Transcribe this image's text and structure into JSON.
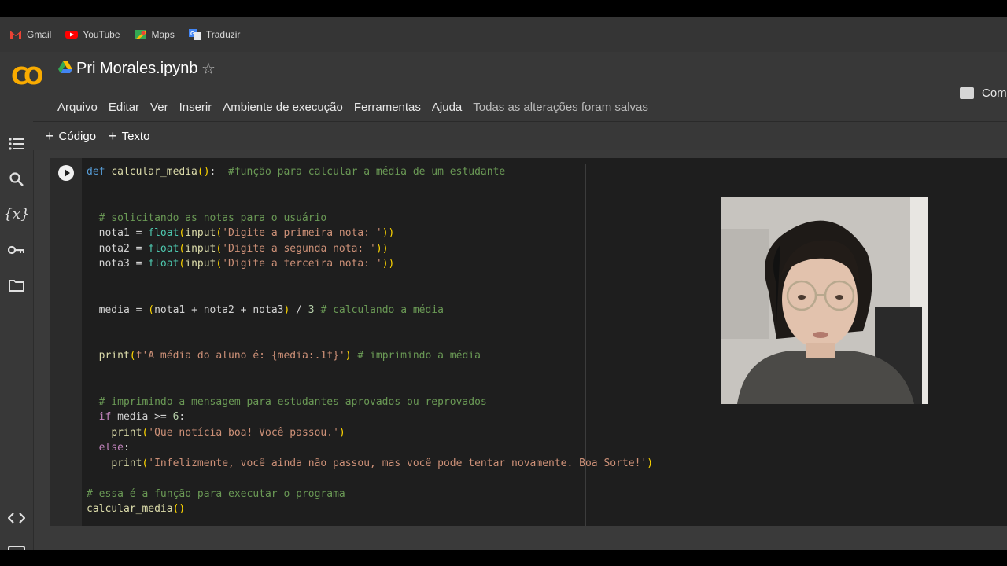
{
  "bookmarks": [
    {
      "label": "Gmail",
      "icon": "gmail-icon",
      "color": "#ea4335"
    },
    {
      "label": "YouTube",
      "icon": "youtube-icon",
      "color": "#ff0000"
    },
    {
      "label": "Maps",
      "icon": "maps-icon",
      "color": "#34a853"
    },
    {
      "label": "Traduzir",
      "icon": "translate-icon",
      "color": "#4285f4"
    }
  ],
  "header": {
    "logo": "CO",
    "notebook_title": "Pri Morales.ipynb",
    "star": "☆",
    "comment_label": "Come",
    "menu": [
      "Arquivo",
      "Editar",
      "Ver",
      "Inserir",
      "Ambiente de execução",
      "Ferramentas",
      "Ajuda"
    ],
    "saved_status": "Todas as alterações foram salvas"
  },
  "toolbar": {
    "code_label": "Código",
    "text_label": "Texto"
  },
  "sidebar": {
    "icons": [
      "table-of-contents-icon",
      "search-icon",
      "variables-icon",
      "secrets-key-icon",
      "files-folder-icon",
      "code-snippets-icon",
      "terminal-icon"
    ],
    "variables_glyph": "{x}"
  },
  "code_lines": [
    "def calcular_media():  #função para calcular a média de um estudante",
    "",
    "",
    "  # solicitando as notas para o usuário",
    "  nota1 = float(input('Digite a primeira nota: '))",
    "  nota2 = float(input('Digite a segunda nota: '))",
    "  nota3 = float(input('Digite a terceira nota: '))",
    "",
    "",
    "  media = (nota1 + nota2 + nota3) / 3 # calculando a média",
    "",
    "",
    "  print(f'A média do aluno é: {media:.1f}') # imprimindo a média",
    "",
    "",
    "  # imprimindo a mensagem para estudantes aprovados ou reprovados",
    "  if media >= 6:",
    "    print('Que notícia boa! Você passou.')",
    "  else:",
    "    print('Infelizmente, você ainda não passou, mas você pode tentar novamente. Boa Sorte!')",
    "",
    "# essa é a função para executar o programa",
    "calcular_media()"
  ],
  "colors": {
    "keyword": "#569cd6",
    "function": "#dcdcaa",
    "comment": "#6a9955",
    "string": "#ce9178",
    "number": "#b5cea8",
    "logo": "#f9ab00"
  }
}
